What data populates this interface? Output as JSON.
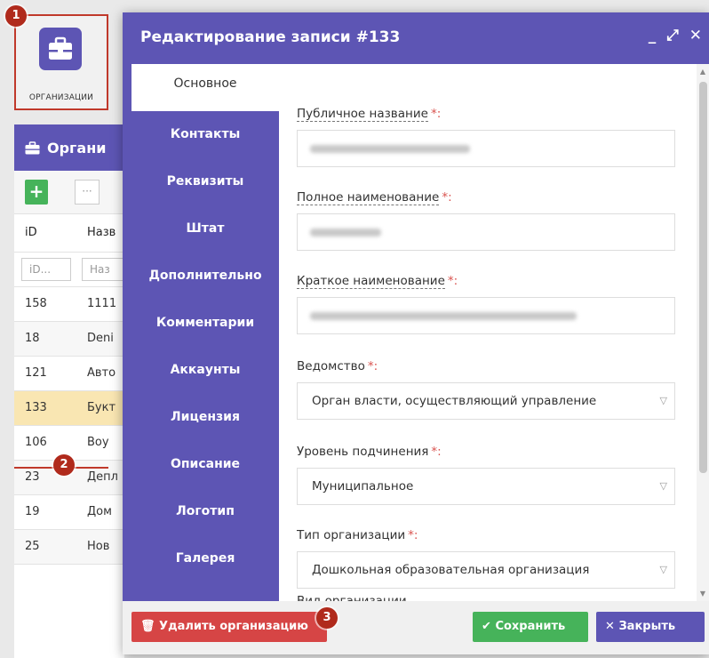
{
  "desktop_icon": {
    "label": "ОРГАНИЗАЦИИ"
  },
  "background_grid": {
    "title": "Органи",
    "header": {
      "id": "iD",
      "name": "Назв"
    },
    "filter": {
      "id_placeholder": "iD...",
      "name_placeholder": "Наз"
    },
    "rows": [
      {
        "id": "158",
        "name": "1111"
      },
      {
        "id": "18",
        "name": "Deni"
      },
      {
        "id": "121",
        "name": "Авто"
      },
      {
        "id": "133",
        "name": "Букт"
      },
      {
        "id": "106",
        "name": "Boy"
      },
      {
        "id": "23",
        "name": "Депл"
      },
      {
        "id": "19",
        "name": "Дом"
      },
      {
        "id": "25",
        "name": "Нов"
      }
    ],
    "more_button": "···"
  },
  "badges": {
    "b1": "1",
    "b2": "2",
    "b3": "3"
  },
  "dialog": {
    "title": "Редактирование записи #133",
    "controls": {
      "minimize": "_",
      "maximize": "⤢",
      "close": "✕"
    },
    "tabs": [
      {
        "label": "Основное"
      },
      {
        "label": "Контакты"
      },
      {
        "label": "Реквизиты"
      },
      {
        "label": "Штат"
      },
      {
        "label": "Дополнительно"
      },
      {
        "label": "Комментарии"
      },
      {
        "label": "Аккаунты"
      },
      {
        "label": "Лицензия"
      },
      {
        "label": "Описание"
      },
      {
        "label": "Логотип"
      },
      {
        "label": "Галерея"
      }
    ],
    "fields": {
      "public_name": {
        "label": "Публичное название",
        "req": "*:"
      },
      "full_name": {
        "label": "Полное наименование",
        "req": "*:"
      },
      "short_name": {
        "label": "Краткое наименование",
        "req": "*:"
      },
      "department": {
        "label": "Ведомство",
        "req": "*:",
        "value": "Орган власти, осуществляющий управление"
      },
      "subordination": {
        "label": "Уровень подчинения",
        "req": "*:",
        "value": "Муниципальное"
      },
      "org_type": {
        "label": "Тип организации",
        "req": "*:",
        "value": "Дошкольная образовательная организация"
      },
      "org_kind": {
        "label": "Вид организации"
      }
    },
    "footer": {
      "delete_label": "Удалить организацию",
      "save_label": "Сохранить",
      "close_label": "Закрыть"
    }
  },
  "colors": {
    "accent": "#5d55b4",
    "danger": "#d64545",
    "success": "#46b35a",
    "highlight": "#f9e6b2"
  }
}
